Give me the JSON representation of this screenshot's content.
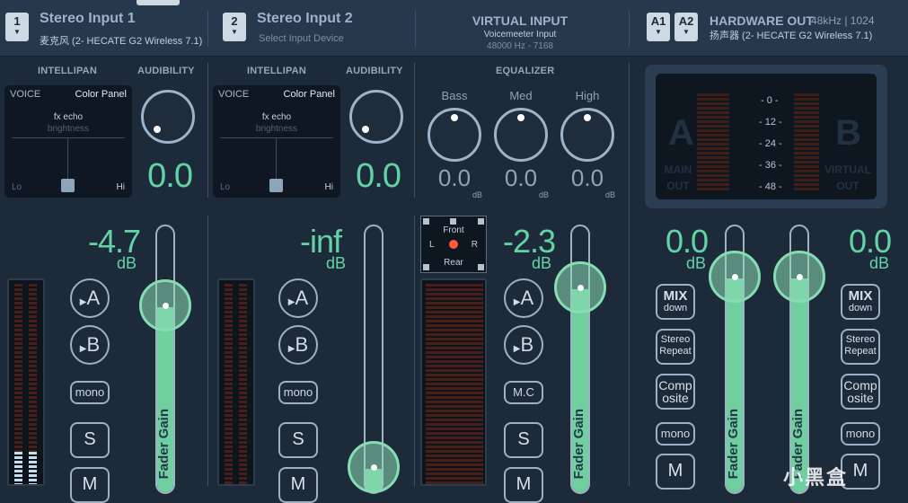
{
  "header": {
    "strip1": {
      "number": "1",
      "title": "Stereo Input 1",
      "device": "麦克风 (2- HECATE G2 Wireless 7.1)"
    },
    "strip2": {
      "number": "2",
      "title": "Stereo Input 2",
      "device": "Select Input Device"
    },
    "virtual": {
      "title": "VIRTUAL INPUT",
      "name": "Voicemeeter Input",
      "format": "48000 Hz - 7168"
    },
    "hardware": {
      "a1": "A1",
      "a2": "A2",
      "title": "HARDWARE OUT",
      "format": "48kHz | 1024",
      "device": "扬声器 (2- HECATE G2 Wireless 7.1)"
    }
  },
  "labels": {
    "intellipan": "INTELLIPAN",
    "audibility": "AUDIBILITY",
    "equalizer": "EQUALIZER"
  },
  "colorpanel": {
    "voice": "VOICE",
    "color_panel": "Color Panel",
    "fx_echo": "fx echo",
    "brightness": "brightness",
    "lo": "Lo",
    "hi": "Hi"
  },
  "audibility": {
    "strip1": "0.0",
    "strip2": "0.0"
  },
  "equalizer": {
    "bands": [
      {
        "label": "Bass",
        "value": "0.0",
        "unit": "dB"
      },
      {
        "label": "Med",
        "value": "0.0",
        "unit": "dB"
      },
      {
        "label": "High",
        "value": "0.0",
        "unit": "dB"
      }
    ]
  },
  "abmonitor": {
    "a": "A",
    "b": "B",
    "main_out": "MAIN\nOUT",
    "virtual_out": "VIRTUAL\nOUT",
    "scale": [
      "- 0 -",
      "- 12 -",
      "- 24 -",
      "- 36 -",
      "- 48 -"
    ]
  },
  "surround": {
    "front": "Front",
    "rear": "Rear",
    "left": "L",
    "right": "R"
  },
  "faders": {
    "strip1": {
      "gain": "-4.7",
      "unit": "dB",
      "label": "Fader Gain",
      "level": 0.72
    },
    "strip2": {
      "gain": "-inf",
      "unit": "dB",
      "label": "Fader Gain",
      "level": 0.0
    },
    "virtual": {
      "gain": "-2.3",
      "unit": "dB",
      "label": "Fader Gain",
      "level": 0.8
    },
    "outA": {
      "gain": "0.0",
      "unit": "dB",
      "label": "Fader Gain",
      "level": 0.85
    },
    "outB": {
      "gain": "0.0",
      "unit": "dB",
      "label": "Fader Gain",
      "level": 0.85
    }
  },
  "buttons": {
    "bus_a": "A",
    "bus_b": "B",
    "mono": "mono",
    "solo": "S",
    "mute": "M",
    "mc": "M.C",
    "mix": "MIX",
    "mix_sub": "down",
    "stereo_repeat": "Stereo\nRepeat",
    "composite": "Comp\nosite"
  },
  "watermark": "小黑盒",
  "colors": {
    "accent": "#63d3a6",
    "background": "#1d2a3a",
    "header": "#26384c"
  }
}
